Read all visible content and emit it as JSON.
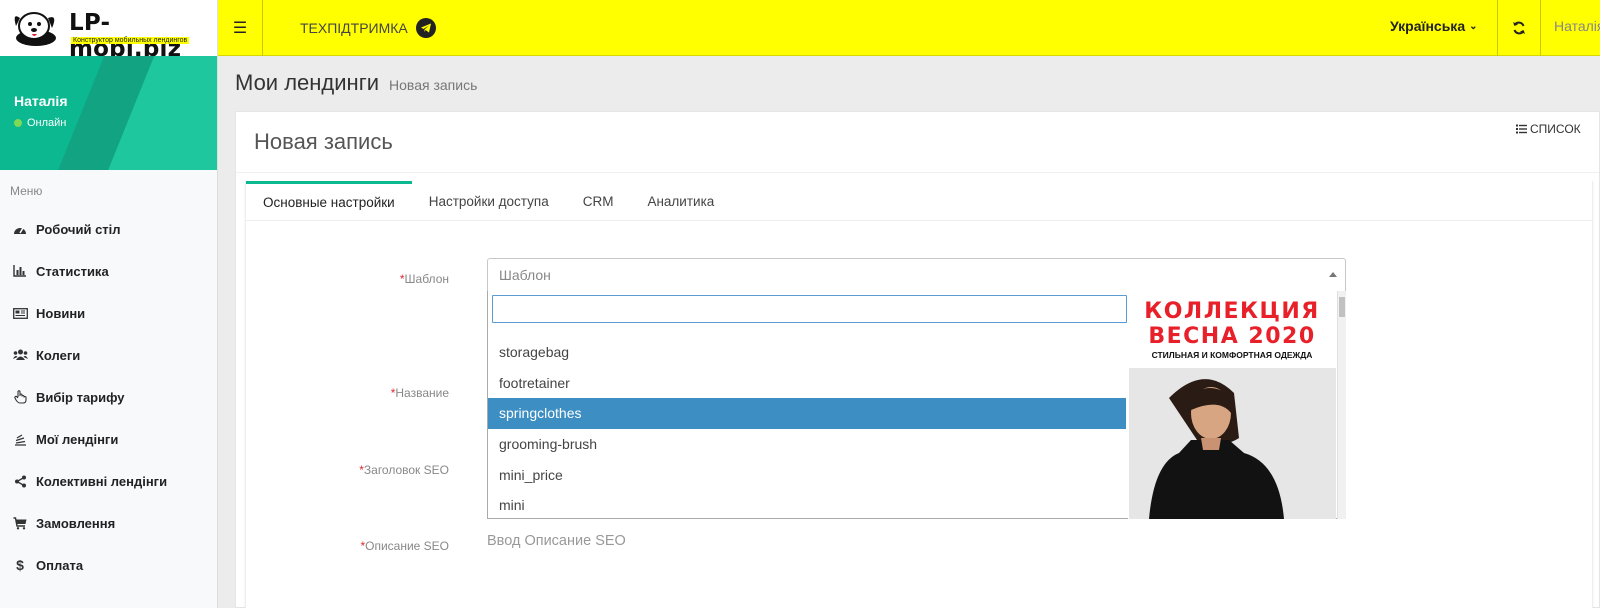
{
  "app": {
    "brand": "LP-mobi.biz",
    "tagline": "Конструктор мобильных лендингов"
  },
  "topbar": {
    "support_label": "ТЕХПІДТРИМКА",
    "language": "Українська",
    "user": "Наталія"
  },
  "sidebar": {
    "user_name": "Наталія",
    "user_status": "Онлайн",
    "menu_title": "Меню",
    "items": [
      {
        "label": "Робочий стіл",
        "icon": "dashboard-icon"
      },
      {
        "label": "Статистика",
        "icon": "bar-chart-icon"
      },
      {
        "label": "Новини",
        "icon": "newspaper-icon"
      },
      {
        "label": "Колеги",
        "icon": "users-icon"
      },
      {
        "label": "Вибір тарифу",
        "icon": "hand-pointer-icon"
      },
      {
        "label": "Мої лендінги",
        "icon": "stack-icon"
      },
      {
        "label": "Колективні лендінги",
        "icon": "share-icon"
      },
      {
        "label": "Замовлення",
        "icon": "cart-icon"
      },
      {
        "label": "Оплата",
        "icon": "dollar-icon"
      }
    ]
  },
  "page": {
    "title": "Мои лендинги",
    "subtitle": "Новая запись",
    "box_title": "Новая запись",
    "list_button": "СПИСОК"
  },
  "tabs": [
    {
      "label": "Основные настройки",
      "active": true
    },
    {
      "label": "Настройки доступа",
      "active": false
    },
    {
      "label": "CRM",
      "active": false
    },
    {
      "label": "Аналитика",
      "active": false
    }
  ],
  "form": {
    "required_mark": "*",
    "template_label": "Шаблон",
    "template_placeholder": "Шаблон",
    "name_label": "Название",
    "seo_title_label": "Заголовок SEO",
    "seo_desc_label": "Описание SEO",
    "seo_desc_placeholder": "Ввод Описание SEO"
  },
  "dropdown": {
    "search_value": "",
    "options": [
      {
        "label": "storagebag",
        "selected": false
      },
      {
        "label": "footretainer",
        "selected": false
      },
      {
        "label": "springclothes",
        "selected": true
      },
      {
        "label": "grooming-brush",
        "selected": false
      },
      {
        "label": "mini_price",
        "selected": false
      },
      {
        "label": "mini",
        "selected": false
      }
    ],
    "preview": {
      "line1": "КОЛЛЕКЦИЯ",
      "line2": "ВЕСНА 2020",
      "line3": "СТИЛЬНАЯ И КОМФОРТНАЯ ОДЕЖДА"
    }
  },
  "colors": {
    "topbar": "#ffff00",
    "sidebar_accent": "#0bb890",
    "selected_option": "#3c8ec3",
    "preview_headline": "#e8202a",
    "required": "#e0282f"
  }
}
